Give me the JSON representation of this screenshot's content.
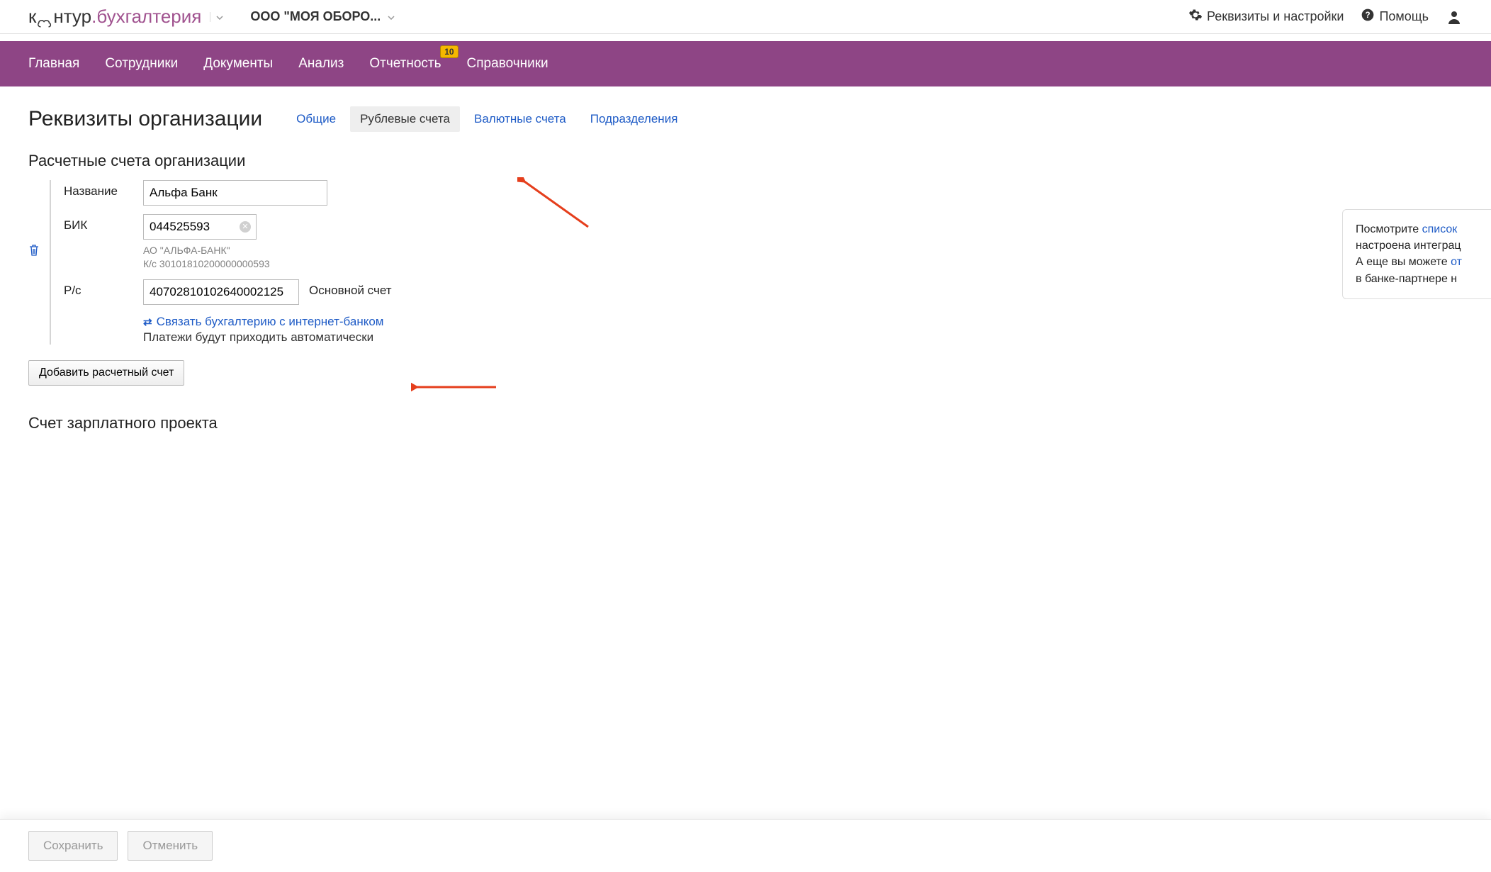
{
  "header": {
    "logo_part1": "к",
    "logo_part2": "нтур",
    "logo_accent": ".бухгалтерия",
    "org_name": "ООО \"МОЯ ОБОРО...",
    "settings_label": "Реквизиты и настройки",
    "help_label": "Помощь"
  },
  "nav": {
    "items": [
      "Главная",
      "Сотрудники",
      "Документы",
      "Анализ",
      "Отчетность",
      "Справочники"
    ],
    "badge_value": "10"
  },
  "page": {
    "title": "Реквизиты организации",
    "tabs": [
      "Общие",
      "Рублевые счета",
      "Валютные счета",
      "Подразделения"
    ]
  },
  "section": {
    "accounts_title": "Расчетные счета организации",
    "salary_title": "Счет зарплатного проекта"
  },
  "form": {
    "name_label": "Название",
    "name_value": "Альфа Банк",
    "bik_label": "БИК",
    "bik_value": "044525593",
    "bank_hint_line1": "АО \"АЛЬФА-БАНК\"",
    "bank_hint_line2": "К/с 30101810200000000593",
    "rs_label": "Р/с",
    "rs_value": "40702810102640002125",
    "rs_note": "Основной счет",
    "link_text": "Связать бухгалтерию с интернет-банком",
    "link_sub": "Платежи будут приходить автоматически",
    "add_btn": "Добавить расчетный счет"
  },
  "info": {
    "line1a": "Посмотрите ",
    "line1b": "список",
    "line2": "настроена интеграц",
    "line3a": "А еще вы можете ",
    "line3b": "от",
    "line4": "в банке-партнере н"
  },
  "footer": {
    "save": "Сохранить",
    "cancel": "Отменить"
  }
}
